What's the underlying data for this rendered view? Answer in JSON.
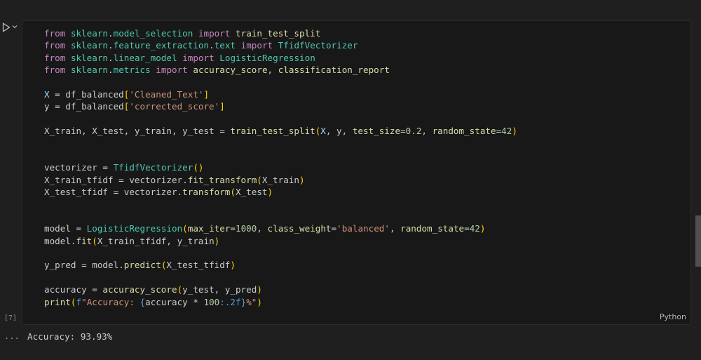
{
  "cell": {
    "execution_count": "[7]",
    "language": "Python",
    "code_lines": [
      "from sklearn.model_selection import train_test_split",
      "from sklearn.feature_extraction.text import TfidfVectorizer",
      "from sklearn.linear_model import LogisticRegression",
      "from sklearn.metrics import accuracy_score, classification_report",
      "",
      "X = df_balanced['Cleaned_Text']",
      "y = df_balanced['corrected_score']",
      "",
      "X_train, X_test, y_train, y_test = train_test_split(X, y, test_size=0.2, random_state=42)",
      "",
      "",
      "vectorizer = TfidfVectorizer()",
      "X_train_tfidf = vectorizer.fit_transform(X_train)",
      "X_test_tfidf = vectorizer.transform(X_test)",
      "",
      "",
      "model = LogisticRegression(max_iter=1000, class_weight='balanced', random_state=42)",
      "model.fit(X_train_tfidf, y_train)",
      "",
      "y_pred = model.predict(X_test_tfidf)",
      "",
      "accuracy = accuracy_score(y_test, y_pred)",
      "print(f\"Accuracy: {accuracy * 100:.2f}%\")"
    ]
  },
  "output": {
    "dots": "...",
    "text": "Accuracy: 93.93%"
  },
  "icons": {
    "run": "run-play-icon",
    "chevron": "chevron-down-icon"
  }
}
